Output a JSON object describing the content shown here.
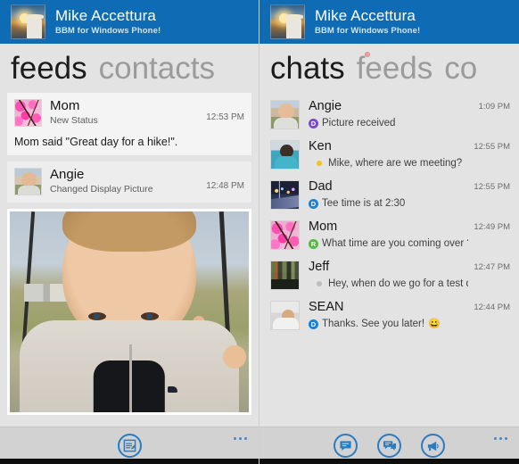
{
  "app": {
    "header": {
      "name": "Mike Accettura",
      "subtitle": "BBM for Windows Phone!",
      "accent": "#0f6cb4",
      "avatar_icon": "sunset-photo-avatar"
    }
  },
  "left_screen": {
    "pivot": {
      "tabs": [
        {
          "label": "feeds",
          "active": true
        },
        {
          "label": "contacts",
          "active": false
        }
      ]
    },
    "feeds": [
      {
        "name": "Mom",
        "action": "New Status",
        "time": "12:53 PM",
        "body_prefix": "Mom",
        "body": " said \"Great day for a hike!\".",
        "avatar_icon": "pink-flowers-thumb",
        "has_photo": false
      },
      {
        "name": "Angie",
        "action": "Changed Display Picture",
        "time": "12:48 PM",
        "avatar_icon": "baby-photo-thumb",
        "has_photo": true,
        "photo_icon": "baby-in-swing-photo"
      }
    ],
    "appbar": {
      "buttons": [
        {
          "icon": "compose-note-icon",
          "label": "New post"
        }
      ],
      "more_label": "more-options"
    }
  },
  "right_screen": {
    "pivot": {
      "tabs": [
        {
          "label": "chats",
          "active": true
        },
        {
          "label": "feeds",
          "active": false
        },
        {
          "label": "co",
          "active": false
        }
      ],
      "marker_color": "#f3a0a0"
    },
    "chats": [
      {
        "name": "Angie",
        "message": "Picture received",
        "time": "1:09 PM",
        "badge": {
          "letter": "D",
          "color": "#7b49c9",
          "type": "letter"
        },
        "avatar_icon": "baby-photo-avatar"
      },
      {
        "name": "Ken",
        "message": "Mike, where are we meeting?",
        "time": "12:55 PM",
        "badge": {
          "letter": "",
          "color": "#f0c419",
          "type": "dot"
        },
        "avatar_icon": "man-teal-shirt-avatar"
      },
      {
        "name": "Dad",
        "message": "Tee time is at 2:30",
        "time": "12:55 PM",
        "badge": {
          "letter": "D",
          "color": "#1a82d6",
          "type": "letter"
        },
        "avatar_icon": "night-cityscape-avatar"
      },
      {
        "name": "Mom",
        "message": "What time are you coming over ?",
        "time": "12:49 PM",
        "badge": {
          "letter": "R",
          "color": "#58b845",
          "type": "letter"
        },
        "avatar_icon": "pink-flowers-avatar"
      },
      {
        "name": "Jeff",
        "message": "Hey, when do we go for a test drive in t",
        "time": "12:47 PM",
        "badge": {
          "letter": "",
          "color": "#bdbdbd",
          "type": "small-dot"
        },
        "avatar_icon": "dark-scene-avatar"
      },
      {
        "name": "SEAN",
        "message": "Thanks.  See you later!",
        "emoji": "😀",
        "time": "12:44 PM",
        "badge": {
          "letter": "D",
          "color": "#1a82d6",
          "type": "letter"
        },
        "avatar_icon": "man-sunglasses-avatar"
      }
    ],
    "appbar": {
      "buttons": [
        {
          "icon": "chat-bubble-icon",
          "label": "New chat"
        },
        {
          "icon": "multi-chat-icon",
          "label": "Multi-person chat"
        },
        {
          "icon": "broadcast-megaphone-icon",
          "label": "Broadcast message"
        }
      ],
      "more_label": "more-options"
    }
  }
}
